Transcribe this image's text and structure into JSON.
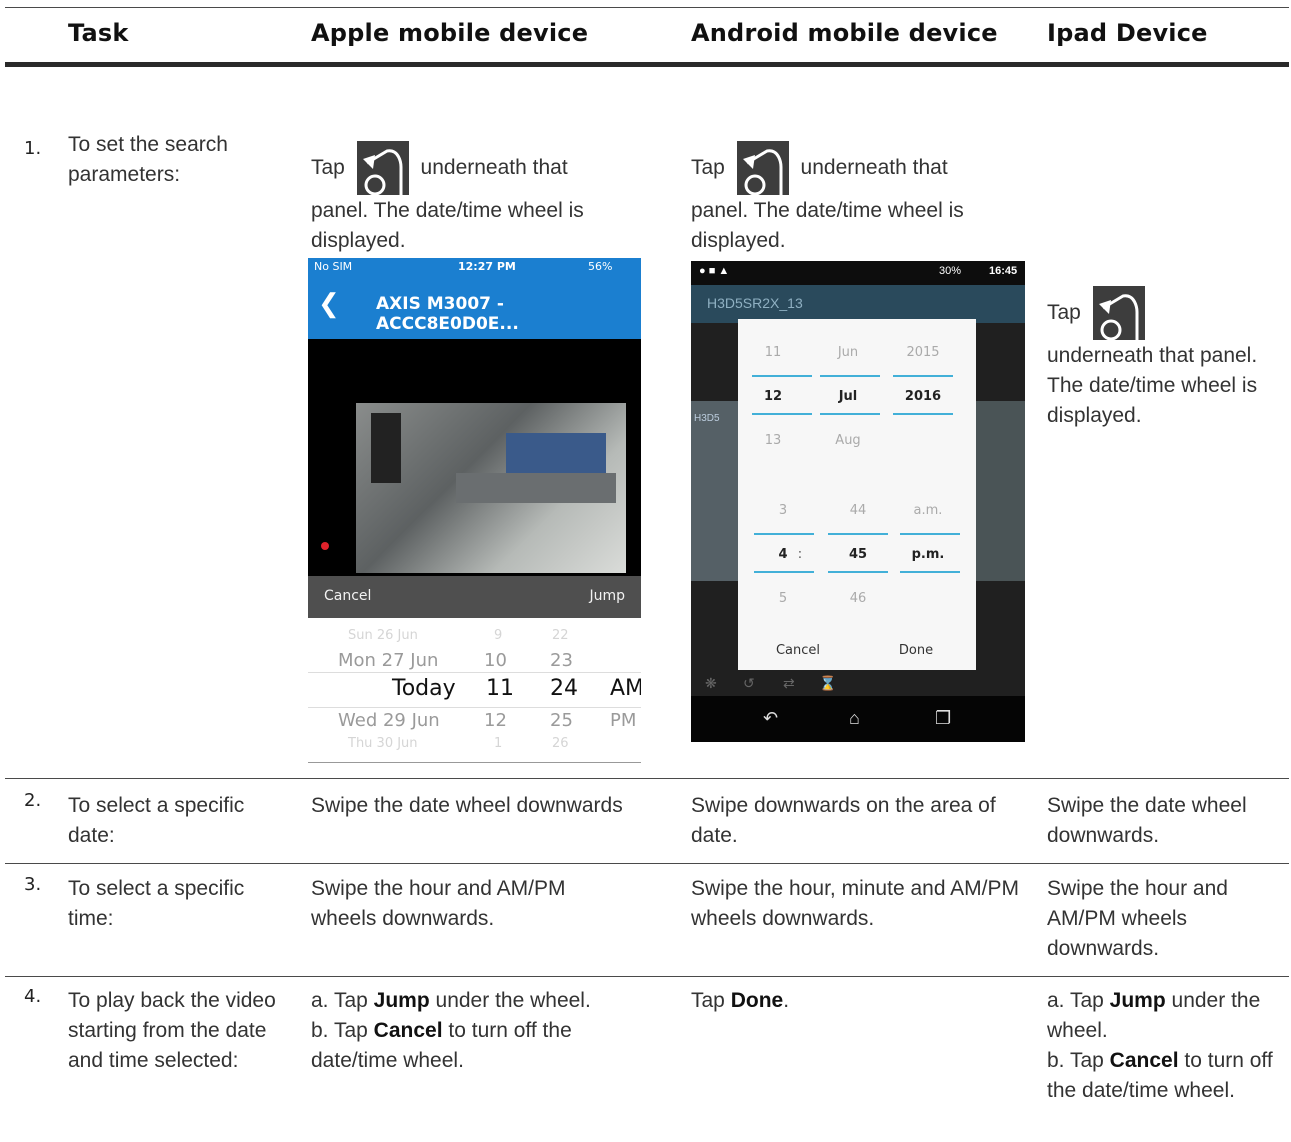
{
  "header": {
    "col_task": "Task",
    "col_apple": "Apple mobile device",
    "col_android": "Android mobile device",
    "col_ipad": "Ipad Device"
  },
  "rows": [
    {
      "num": "1.",
      "task": "To set the search parameters:",
      "apple_pre": "Tap",
      "apple_post": "underneath that",
      "apple_rest": "panel. The date/time wheel is displayed.",
      "android_pre": "Tap",
      "android_post": "underneath that",
      "android_rest": "panel. The date/time wheel is displayed.",
      "ipad_pre": "Tap",
      "ipad_rest": "underneath that panel. The date/time wheel is displayed."
    },
    {
      "num": "2.",
      "task": "To select a specific date:",
      "apple": "Swipe the date wheel downwards",
      "android": "Swipe downwards on the area of date.",
      "ipad": "Swipe the date wheel downwards."
    },
    {
      "num": "3.",
      "task": "To select a specific time:",
      "apple": "Swipe the hour and AM/PM wheels downwards.",
      "android": "Swipe the hour, minute and AM/PM wheels downwards.",
      "ipad": "Swipe the hour and AM/PM wheels downwards."
    },
    {
      "num": "4.",
      "task": "To play back the video starting from the date and time selected:",
      "apple_a_pre": "a. Tap ",
      "apple_a_bold": "Jump",
      "apple_a_post": " under the wheel.",
      "apple_b_pre": "b. Tap ",
      "apple_b_bold": "Cancel",
      "apple_b_post": " to turn off the date/time wheel.",
      "android_pre": "Tap ",
      "android_bold": "Done",
      "android_post": ".",
      "ipad_a_pre": "a. Tap ",
      "ipad_a_bold": "Jump",
      "ipad_a_post": " under the wheel.",
      "ipad_b_pre": "b. Tap ",
      "ipad_b_bold": "Cancel",
      "ipad_b_post": " to turn off the date/time wheel."
    }
  ],
  "apple_screen": {
    "carrier": "No SIM",
    "time": "12:27 PM",
    "battery": "56%",
    "title": "AXIS M3007 - ACCC8E0D0E...",
    "cancel": "Cancel",
    "jump": "Jump",
    "picker": {
      "dates": [
        "Sun 26 Jun",
        "Mon 27 Jun",
        "Today",
        "Wed 29 Jun",
        "Thu 30 Jun"
      ],
      "hours": [
        "9",
        "10",
        "11",
        "12",
        "1"
      ],
      "minutes": [
        "22",
        "23",
        "24",
        "25",
        "26"
      ],
      "ampm": [
        "AM",
        "PM"
      ]
    }
  },
  "android_screen": {
    "status_right": "30%",
    "clock": "16:45",
    "camera": "H3D5SR2X_13",
    "side_label": "H3D5",
    "days": [
      "11",
      "12",
      "13"
    ],
    "months": [
      "Jun",
      "Jul",
      "Aug"
    ],
    "years": [
      "2015",
      "2016"
    ],
    "hours": [
      "3",
      "4",
      "5"
    ],
    "minutes": [
      "44",
      "45",
      "46"
    ],
    "ampm": [
      "a.m.",
      "p.m."
    ],
    "colon": ":",
    "cancel": "Cancel",
    "done": "Done"
  },
  "colors": {
    "apple_blue": "#1b7fd0",
    "android_accent": "#42b0d8",
    "icon_bg": "#3d3d3d"
  },
  "icons": [
    "reset-icon",
    "back-icon",
    "bluetooth-icon",
    "wifi-icon"
  ]
}
